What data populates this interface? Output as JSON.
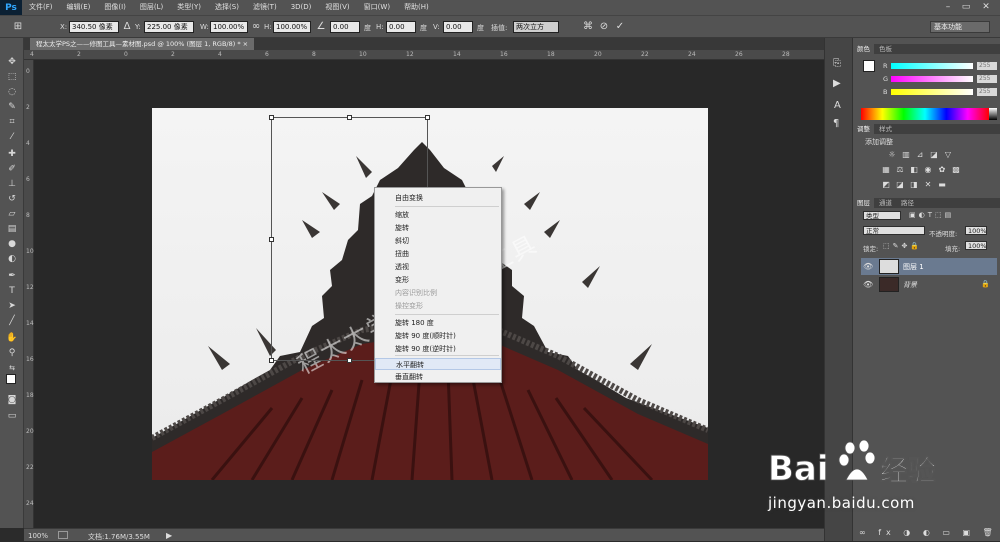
{
  "app": {
    "logo": "Ps",
    "menu": [
      "文件(F)",
      "编辑(E)",
      "图像(I)",
      "图层(L)",
      "类型(Y)",
      "选择(S)",
      "滤镜(T)",
      "3D(D)",
      "视图(V)",
      "窗口(W)",
      "帮助(H)"
    ],
    "workspace": "基本功能"
  },
  "options": {
    "x_label": "X:",
    "x_value": "340.50 像素",
    "y_label": "Y:",
    "y_value": "225.00 像素",
    "w_label": "W:",
    "w_value": "100.00%",
    "h_label": "H:",
    "h_value": "100.00%",
    "angle_value": "0.00",
    "angle_unit": "度",
    "hskew_label": "H:",
    "hskew_value": "0.00",
    "hskew_unit": "度",
    "vskew_label": "V:",
    "vskew_value": "0.00",
    "vskew_unit": "度",
    "interp_label": "插值:",
    "interp_value": "两次立方"
  },
  "document": {
    "tab_title": "程太太学PS之——修图工具—素材图.psd @ 100% (图层 1, RGB/8) *",
    "ruler_top_marks": [
      "4",
      "2",
      "0",
      "2",
      "4",
      "6",
      "8",
      "10",
      "12",
      "14",
      "16",
      "18",
      "20",
      "22",
      "24",
      "26",
      "28"
    ],
    "ruler_left_marks": [
      "0",
      "2",
      "4",
      "6",
      "8",
      "10",
      "12",
      "14",
      "16",
      "18",
      "20",
      "22",
      "24"
    ],
    "zoom": "100%",
    "doc_info": "文档:1.76M/3.55M",
    "watermark_text": "程太太学PS之修图工具"
  },
  "context_menu": {
    "items": [
      {
        "label": "自由变换",
        "state": "normal"
      },
      {
        "label": "缩放",
        "state": "normal"
      },
      {
        "label": "旋转",
        "state": "normal"
      },
      {
        "label": "斜切",
        "state": "normal"
      },
      {
        "label": "扭曲",
        "state": "normal"
      },
      {
        "label": "透视",
        "state": "normal"
      },
      {
        "label": "变形",
        "state": "normal"
      },
      {
        "label": "内容识别比例",
        "state": "disabled"
      },
      {
        "label": "操控变形",
        "state": "disabled"
      },
      {
        "label": "旋转 180 度",
        "state": "normal"
      },
      {
        "label": "旋转 90 度(顺时针)",
        "state": "normal"
      },
      {
        "label": "旋转 90 度(逆时针)",
        "state": "normal"
      },
      {
        "label": "水平翻转",
        "state": "highlight"
      },
      {
        "label": "垂直翻转",
        "state": "normal"
      }
    ]
  },
  "panels": {
    "color_tabs": [
      "颜色",
      "色板"
    ],
    "color": {
      "r_label": "R",
      "g_label": "G",
      "b_label": "B",
      "r_value": "255",
      "g_value": "255",
      "b_value": "255"
    },
    "adjust_tabs": [
      "调整",
      "样式"
    ],
    "adjust_title": "添加调整",
    "layers_tabs": [
      "图层",
      "通道",
      "路径"
    ],
    "kind_filter": "类型",
    "blend_mode": "正常",
    "opacity_label": "不透明度:",
    "opacity_value": "100%",
    "lock_label": "锁定:",
    "fill_label": "填充:",
    "fill_value": "100%",
    "layers": [
      {
        "name": "图层 1",
        "selected": true
      },
      {
        "name": "背景",
        "selected": false
      }
    ]
  },
  "watermark": {
    "brand": "Bai",
    "brand_suffix": "经验",
    "url": "jingyan.baidu.com"
  },
  "colors": {
    "ui_dark": "#535353",
    "canvas_bg": "#282828",
    "roof_red": "#5a1a1a",
    "roof_dark": "#2d2826",
    "selected_layer": "#6a7a90",
    "highlight": "#e1e9f6"
  }
}
